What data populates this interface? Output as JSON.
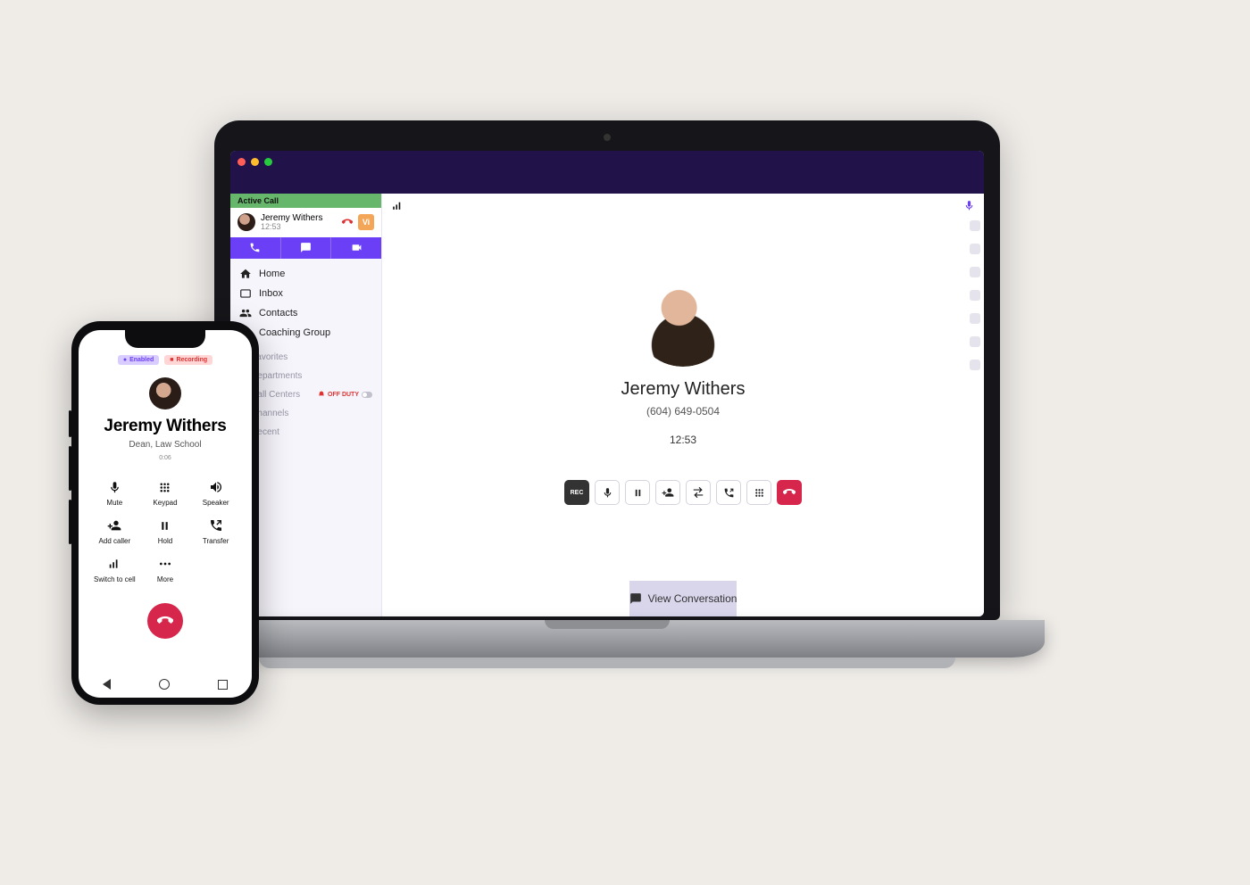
{
  "desktop": {
    "active_call_banner": "Active Call",
    "caller": {
      "name": "Jeremy Withers",
      "phone": "(604) 649-0504",
      "duration": "12:53",
      "badge": "Vi"
    },
    "nav": {
      "home": "Home",
      "inbox": "Inbox",
      "contacts": "Contacts",
      "coaching": "Coaching Group"
    },
    "groups": {
      "favorites": "Favorites",
      "departments": "Departments",
      "call_centers": "Call Centers",
      "channels": "Channels",
      "recent": "Recent",
      "off_duty": "OFF DUTY"
    },
    "view_conversation": "View Conversation",
    "controls": {
      "record": "REC",
      "mic": "mic",
      "pause": "pause",
      "add_person": "add-person",
      "transfer": "transfer",
      "call_swap": "call-swap",
      "dialpad": "dialpad",
      "hangup": "hangup"
    }
  },
  "phone": {
    "badges": {
      "enabled": "Enabled",
      "recording": "Recording"
    },
    "caller": {
      "name": "Jeremy Withers",
      "subtitle": "Dean, Law School",
      "duration": "0:06"
    },
    "grid": {
      "mute": "Mute",
      "keypad": "Keypad",
      "speaker": "Speaker",
      "add_caller": "Add caller",
      "hold": "Hold",
      "transfer": "Transfer",
      "switch": "Switch to cell",
      "more": "More"
    }
  }
}
